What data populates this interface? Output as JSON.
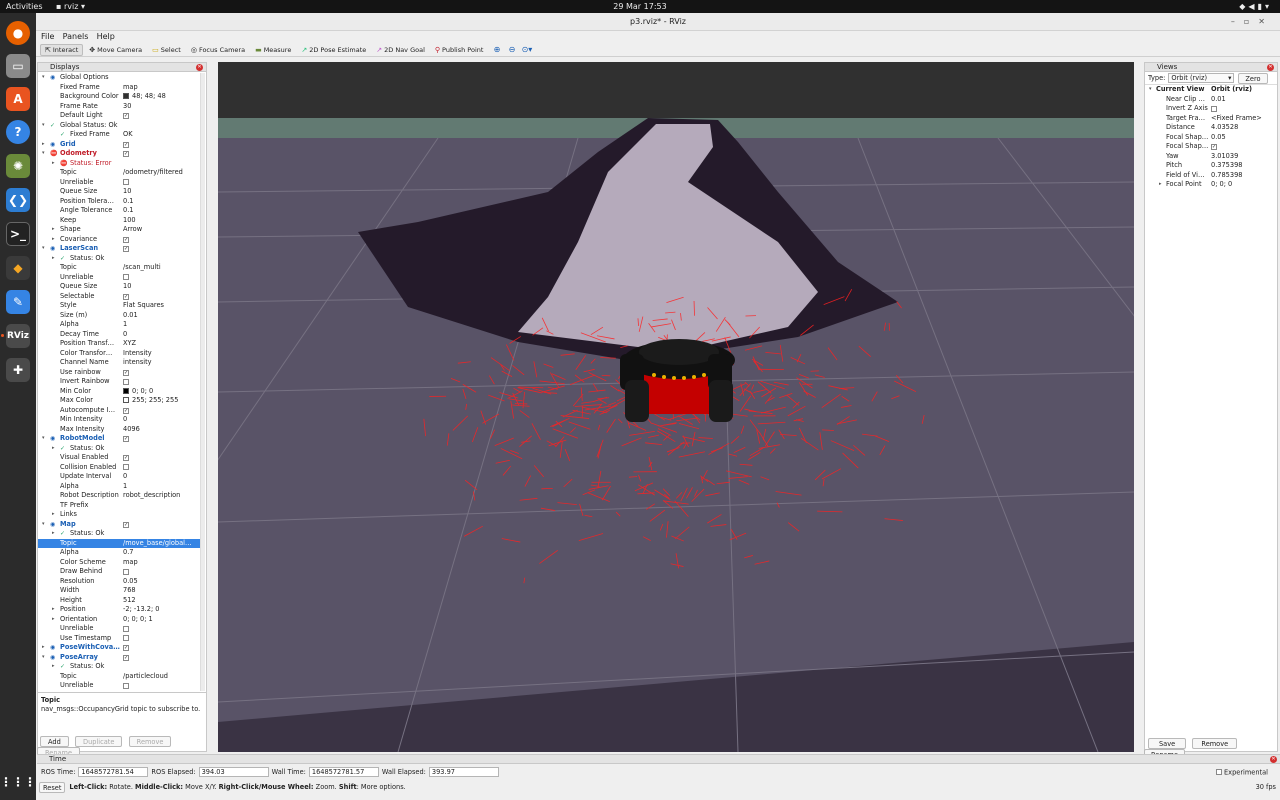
{
  "topbar": {
    "activities": "Activities",
    "app": "rviz",
    "clock": "29 Mar  17:53"
  },
  "window": {
    "title": "p3.rviz* - RViz"
  },
  "menu": [
    "File",
    "Panels",
    "Help"
  ],
  "toolbar": [
    "Interact",
    "Move Camera",
    "Select",
    "Focus Camera",
    "Measure",
    "2D Pose Estimate",
    "2D Nav Goal",
    "Publish Point"
  ],
  "displays": {
    "title": "Displays",
    "rows": [
      {
        "name": "Global Options",
        "value": "",
        "level": 1,
        "exp": "▾"
      },
      {
        "name": "Fixed Frame",
        "value": "map",
        "level": 2
      },
      {
        "name": "Background Color",
        "value": "48; 48; 48",
        "level": 2,
        "swatch": "#303030"
      },
      {
        "name": "Frame Rate",
        "value": "30",
        "level": 2
      },
      {
        "name": "Default Light",
        "value": "",
        "level": 2,
        "check": true
      },
      {
        "name": "Global Status: Ok",
        "value": "",
        "level": 1,
        "exp": "▾",
        "ok": true
      },
      {
        "name": "Fixed Frame",
        "value": "OK",
        "level": 2,
        "ok": true
      },
      {
        "name": "Grid",
        "value": "",
        "level": 1,
        "exp": "▸",
        "hdr": true,
        "check": true
      },
      {
        "name": "Odometry",
        "value": "",
        "level": 1,
        "exp": "▾",
        "hdr": true,
        "err": true,
        "check": true
      },
      {
        "name": "Status: Error",
        "value": "",
        "level": 2,
        "exp": "▸",
        "errtext": true
      },
      {
        "name": "Topic",
        "value": "/odometry/filtered",
        "level": 2
      },
      {
        "name": "Unreliable",
        "value": "",
        "level": 2,
        "check": false
      },
      {
        "name": "Queue Size",
        "value": "10",
        "level": 2
      },
      {
        "name": "Position Tolera…",
        "value": "0.1",
        "level": 2
      },
      {
        "name": "Angle Tolerance",
        "value": "0.1",
        "level": 2
      },
      {
        "name": "Keep",
        "value": "100",
        "level": 2
      },
      {
        "name": "Shape",
        "value": "Arrow",
        "level": 2,
        "exp": "▸"
      },
      {
        "name": "Covariance",
        "value": "",
        "level": 2,
        "exp": "▸",
        "check": true
      },
      {
        "name": "LaserScan",
        "value": "",
        "level": 1,
        "exp": "▾",
        "hdr": true,
        "check": true
      },
      {
        "name": "Status: Ok",
        "value": "",
        "level": 2,
        "exp": "▸",
        "ok": true
      },
      {
        "name": "Topic",
        "value": "/scan_multi",
        "level": 2
      },
      {
        "name": "Unreliable",
        "value": "",
        "level": 2,
        "check": false
      },
      {
        "name": "Queue Size",
        "value": "10",
        "level": 2
      },
      {
        "name": "Selectable",
        "value": "",
        "level": 2,
        "check": true
      },
      {
        "name": "Style",
        "value": "Flat Squares",
        "level": 2
      },
      {
        "name": "Size (m)",
        "value": "0.01",
        "level": 2
      },
      {
        "name": "Alpha",
        "value": "1",
        "level": 2
      },
      {
        "name": "Decay Time",
        "value": "0",
        "level": 2
      },
      {
        "name": "Position Transf…",
        "value": "XYZ",
        "level": 2
      },
      {
        "name": "Color Transfor…",
        "value": "Intensity",
        "level": 2
      },
      {
        "name": "Channel Name",
        "value": "intensity",
        "level": 2
      },
      {
        "name": "Use rainbow",
        "value": "",
        "level": 2,
        "check": true
      },
      {
        "name": "Invert Rainbow",
        "value": "",
        "level": 2,
        "check": false
      },
      {
        "name": "Min Color",
        "value": "0; 0; 0",
        "level": 2,
        "swatch": "#000000"
      },
      {
        "name": "Max Color",
        "value": "255; 255; 255",
        "level": 2,
        "swatch": "#ffffff"
      },
      {
        "name": "Autocompute I…",
        "value": "",
        "level": 2,
        "check": true
      },
      {
        "name": "Min Intensity",
        "value": "0",
        "level": 2
      },
      {
        "name": "Max Intensity",
        "value": "4096",
        "level": 2
      },
      {
        "name": "RobotModel",
        "value": "",
        "level": 1,
        "exp": "▾",
        "hdr": true,
        "check": true
      },
      {
        "name": "Status: Ok",
        "value": "",
        "level": 2,
        "exp": "▸",
        "ok": true
      },
      {
        "name": "Visual Enabled",
        "value": "",
        "level": 2,
        "check": true
      },
      {
        "name": "Collision Enabled",
        "value": "",
        "level": 2,
        "check": false
      },
      {
        "name": "Update Interval",
        "value": "0",
        "level": 2
      },
      {
        "name": "Alpha",
        "value": "1",
        "level": 2
      },
      {
        "name": "Robot Description",
        "value": "robot_description",
        "level": 2
      },
      {
        "name": "TF Prefix",
        "value": "",
        "level": 2
      },
      {
        "name": "Links",
        "value": "",
        "level": 2,
        "exp": "▸"
      },
      {
        "name": "Map",
        "value": "",
        "level": 1,
        "exp": "▾",
        "hdr": true,
        "check": true
      },
      {
        "name": "Status: Ok",
        "value": "",
        "level": 2,
        "exp": "▸",
        "ok": true
      },
      {
        "name": "Topic",
        "value": "/move_base/global…",
        "level": 2,
        "sel": true
      },
      {
        "name": "Alpha",
        "value": "0.7",
        "level": 2
      },
      {
        "name": "Color Scheme",
        "value": "map",
        "level": 2
      },
      {
        "name": "Draw Behind",
        "value": "",
        "level": 2,
        "check": false
      },
      {
        "name": "Resolution",
        "value": "0.05",
        "level": 2
      },
      {
        "name": "Width",
        "value": "768",
        "level": 2
      },
      {
        "name": "Height",
        "value": "512",
        "level": 2
      },
      {
        "name": "Position",
        "value": "-2; -13.2; 0",
        "level": 2,
        "exp": "▸"
      },
      {
        "name": "Orientation",
        "value": "0; 0; 0; 1",
        "level": 2,
        "exp": "▸"
      },
      {
        "name": "Unreliable",
        "value": "",
        "level": 2,
        "check": false
      },
      {
        "name": "Use Timestamp",
        "value": "",
        "level": 2,
        "check": false
      },
      {
        "name": "PoseWithCova…",
        "value": "",
        "level": 1,
        "exp": "▸",
        "hdr": true,
        "check": true
      },
      {
        "name": "PoseArray",
        "value": "",
        "level": 1,
        "exp": "▾",
        "hdr": true,
        "check": true
      },
      {
        "name": "Status: Ok",
        "value": "",
        "level": 2,
        "exp": "▸",
        "ok": true
      },
      {
        "name": "Topic",
        "value": "/particlecloud",
        "level": 2
      },
      {
        "name": "Unreliable",
        "value": "",
        "level": 2,
        "check": false
      }
    ],
    "desc_title": "Topic",
    "desc_text": "nav_msgs::OccupancyGrid topic to subscribe to.",
    "buttons": [
      "Add",
      "Duplicate",
      "Remove",
      "Rename"
    ]
  },
  "views": {
    "title": "Views",
    "type_label": "Type:",
    "type_value": "Orbit (rviz)",
    "zero": "Zero",
    "rows": [
      {
        "name": "Current View",
        "value": "Orbit (rviz)",
        "bold": true,
        "exp": "▾"
      },
      {
        "name": "Near Clip …",
        "value": "0.01"
      },
      {
        "name": "Invert Z Axis",
        "value": "",
        "check": false
      },
      {
        "name": "Target Fra…",
        "value": "<Fixed Frame>"
      },
      {
        "name": "Distance",
        "value": "4.03528"
      },
      {
        "name": "Focal Shap…",
        "value": "0.05"
      },
      {
        "name": "Focal Shap…",
        "value": "",
        "check": true
      },
      {
        "name": "Yaw",
        "value": "3.01039"
      },
      {
        "name": "Pitch",
        "value": "0.375398"
      },
      {
        "name": "Field of Vi…",
        "value": "0.785398"
      },
      {
        "name": "Focal Point",
        "value": "0; 0; 0",
        "exp": "▸"
      }
    ],
    "buttons": [
      "Save",
      "Remove",
      "Rename"
    ]
  },
  "time": {
    "title": "Time",
    "ros_time_label": "ROS Time:",
    "ros_time": "1648572781.54",
    "ros_elapsed_label": "ROS Elapsed:",
    "ros_elapsed": "394.03",
    "wall_time_label": "Wall Time:",
    "wall_time": "1648572781.57",
    "wall_elapsed_label": "Wall Elapsed:",
    "wall_elapsed": "393.97",
    "experimental": "Experimental",
    "reset": "Reset",
    "help_b1": "Left-Click:",
    "help_t1": " Rotate. ",
    "help_b2": "Middle-Click:",
    "help_t2": " Move X/Y. ",
    "help_b3": "Right-Click/Mouse Wheel:",
    "help_t3": " Zoom. ",
    "help_b4": "Shift",
    "help_t4": ": More options.",
    "fps": "30 fps"
  }
}
